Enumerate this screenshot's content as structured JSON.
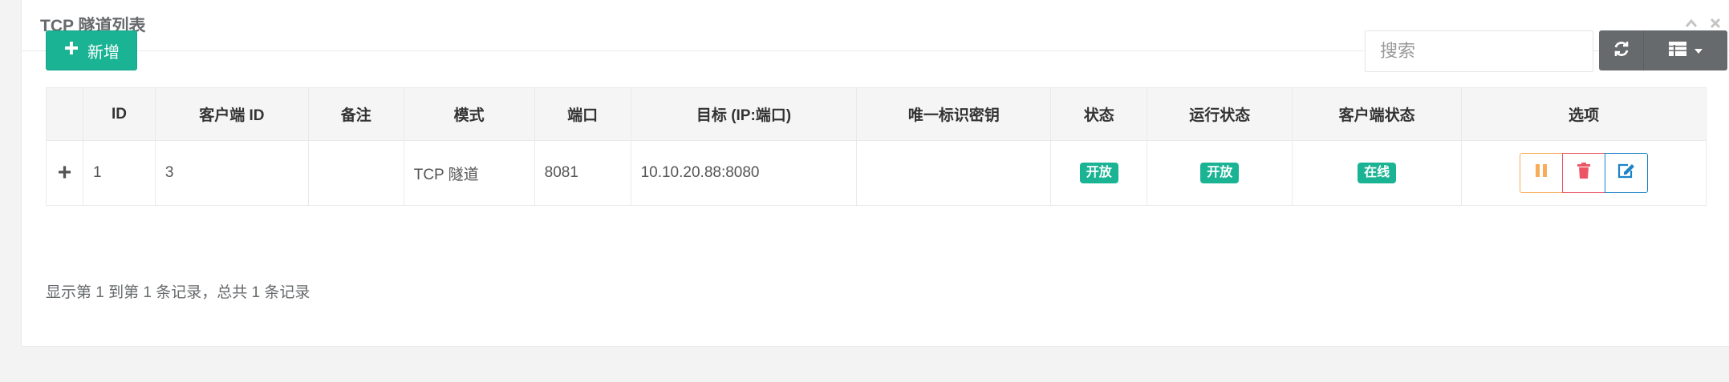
{
  "panel": {
    "title": "TCP 隧道列表"
  },
  "toolbar": {
    "add_label": "新增",
    "search_placeholder": "搜索"
  },
  "table": {
    "columns": [
      "",
      "ID",
      "客户端 ID",
      "备注",
      "模式",
      "端口",
      "目标 (IP:端口)",
      "唯一标识密钥",
      "状态",
      "运行状态",
      "客户端状态",
      "选项"
    ],
    "rows": [
      {
        "expand": "+",
        "id": "1",
        "client_id": "3",
        "remark": "",
        "mode": "TCP 隧道",
        "port": "8081",
        "target": "10.10.20.88:8080",
        "key": "",
        "status": "开放",
        "run_status": "开放",
        "client_status": "在线"
      }
    ]
  },
  "footer": {
    "info": "显示第 1 到第 1 条记录，总共 1 条记录"
  },
  "colors": {
    "primary": "#1ab394",
    "warning": "#f8ac59",
    "danger": "#ed5565",
    "info": "#1c84c6",
    "toolbar_gray": "#676a6c"
  }
}
